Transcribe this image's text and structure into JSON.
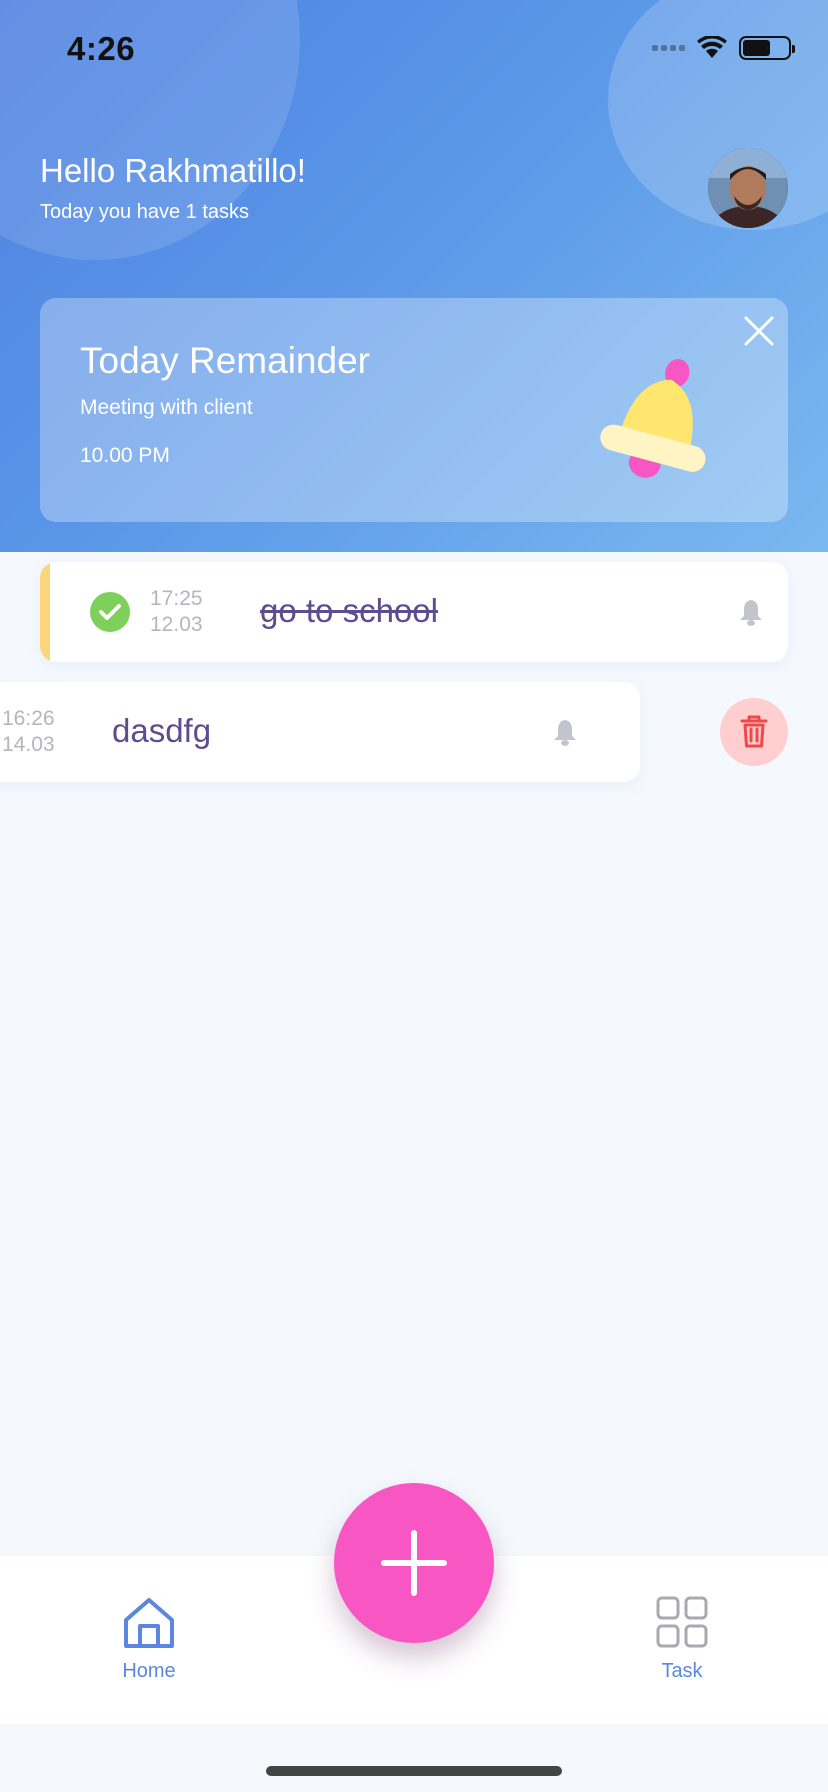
{
  "status_bar": {
    "time": "4:26"
  },
  "header": {
    "greeting": "Hello Rakhmatillo!",
    "subtitle": "Today you have 1 tasks"
  },
  "reminder": {
    "title": "Today Remainder",
    "subtitle": "Meeting with client",
    "time": "10.00 PM"
  },
  "tasks": [
    {
      "time": "17:25",
      "date": "12.03",
      "name": "go to school",
      "done": true
    },
    {
      "time": "16:26",
      "date": "14.03",
      "name": "dasdfg",
      "done": false
    }
  ],
  "nav": {
    "home_label": "Home",
    "task_label": "Task"
  },
  "colors": {
    "accent_blue": "#5b87de",
    "fab_pink": "#f857c3",
    "task_text": "#5c4d8f",
    "check_green": "#7dd05a",
    "delete_bg": "#ffcfcf",
    "task_accent": "#fbd67a"
  }
}
